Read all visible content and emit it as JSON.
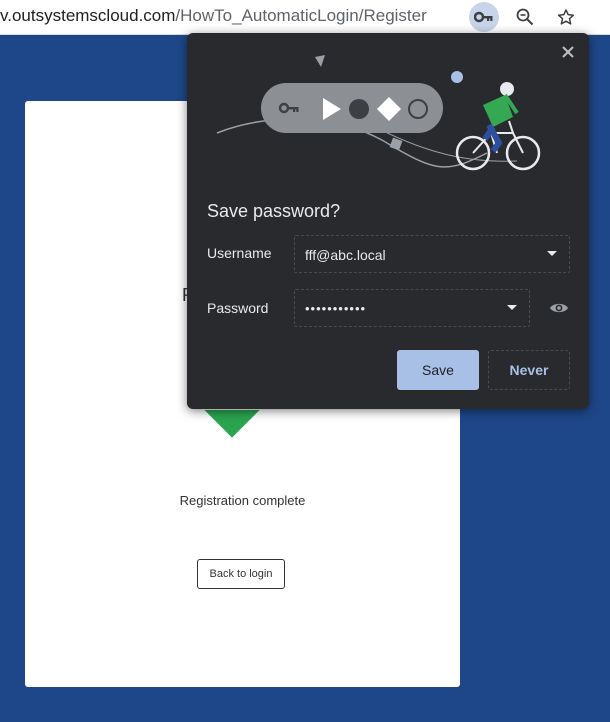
{
  "browser": {
    "url_host": "v.outsystemscloud.com",
    "url_path": "/HowTo_AutomaticLogin/Register",
    "icons": {
      "key": "key-icon",
      "zoom": "zoom-icon",
      "star": "star-icon"
    }
  },
  "page": {
    "card_peek_char": "R",
    "registration_text": "Registration complete",
    "back_button_label": "Back to login"
  },
  "popup": {
    "title": "Save password?",
    "username_label": "Username",
    "username_value": "fff@abc.local",
    "password_label": "Password",
    "password_value": "•••••••••••",
    "save_label": "Save",
    "never_label": "Never"
  },
  "colors": {
    "page_background": "#1e4789",
    "popup_background": "#292a2d",
    "save_button": "#a8c0e6",
    "success_green": "#2aa44f"
  }
}
